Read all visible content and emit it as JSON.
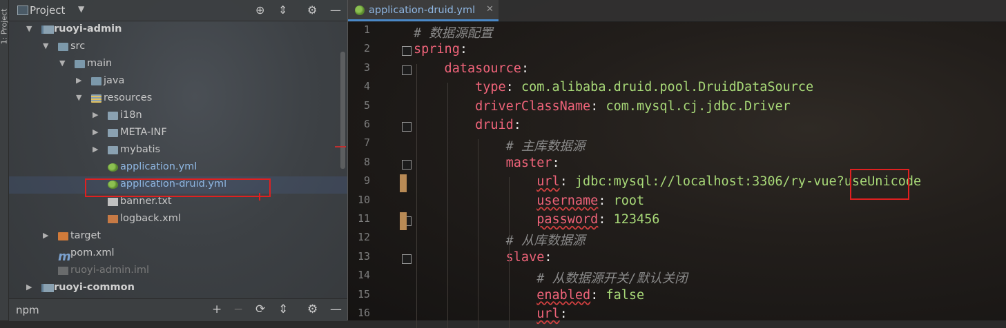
{
  "side_strip": {
    "label": "1: Project"
  },
  "project_panel": {
    "title": "Project",
    "toolbar_icons": [
      "target-icon",
      "collapse-icon",
      "gear-icon",
      "minimize-icon"
    ],
    "tree": [
      {
        "label": "ruoyi-admin",
        "kind": "module",
        "level": 0,
        "expanded": true
      },
      {
        "label": "src",
        "kind": "folder",
        "level": 1,
        "expanded": true
      },
      {
        "label": "main",
        "kind": "folder",
        "level": 2,
        "expanded": true
      },
      {
        "label": "java",
        "kind": "folder",
        "level": 3,
        "expanded": false
      },
      {
        "label": "resources",
        "kind": "folder",
        "level": 3,
        "expanded": true
      },
      {
        "label": "i18n",
        "kind": "folder",
        "level": 4,
        "expanded": false
      },
      {
        "label": "META-INF",
        "kind": "folder",
        "level": 4,
        "expanded": false
      },
      {
        "label": "mybatis",
        "kind": "folder",
        "level": 4,
        "expanded": false
      },
      {
        "label": "application.yml",
        "kind": "yml",
        "level": 4
      },
      {
        "label": "application-druid.yml",
        "kind": "yml",
        "level": 4,
        "selected": true
      },
      {
        "label": "banner.txt",
        "kind": "txt",
        "level": 4
      },
      {
        "label": "logback.xml",
        "kind": "xml",
        "level": 4
      },
      {
        "label": "target",
        "kind": "target",
        "level": 1,
        "expanded": false
      },
      {
        "label": "pom.xml",
        "kind": "maven",
        "level": 1
      },
      {
        "label": "ruoyi-admin.iml",
        "kind": "iml",
        "level": 1
      },
      {
        "label": "ruoyi-common",
        "kind": "module",
        "level": 0,
        "expanded": false
      }
    ]
  },
  "bottom_bar": {
    "label": "npm",
    "icons": [
      "add-icon",
      "remove-icon",
      "refresh-icon",
      "collapse-icon",
      "gear-icon",
      "minimize-icon"
    ]
  },
  "editor": {
    "tab": {
      "label": "application-druid.yml"
    },
    "line_numbers": [
      "1",
      "2",
      "3",
      "4",
      "5",
      "6",
      "7",
      "8",
      "9",
      "10",
      "11",
      "12",
      "13",
      "14",
      "15",
      "16"
    ],
    "lines": [
      [
        {
          "t": "# 数据源配置",
          "c": "cmt"
        }
      ],
      [
        {
          "t": "spring",
          "c": "key"
        },
        {
          "t": ":",
          "c": "white"
        }
      ],
      [
        {
          "t": "    datasource",
          "c": "key"
        },
        {
          "t": ":",
          "c": "white"
        }
      ],
      [
        {
          "t": "        type",
          "c": "key"
        },
        {
          "t": ": ",
          "c": "white"
        },
        {
          "t": "com.alibaba.druid.pool.DruidDataSource",
          "c": "val"
        }
      ],
      [
        {
          "t": "        driverClassName",
          "c": "key"
        },
        {
          "t": ": ",
          "c": "white"
        },
        {
          "t": "com.mysql.cj.jdbc.Driver",
          "c": "val"
        }
      ],
      [
        {
          "t": "        druid",
          "c": "key"
        },
        {
          "t": ":",
          "c": "white"
        }
      ],
      [
        {
          "t": "            # 主库数据源",
          "c": "cmt"
        }
      ],
      [
        {
          "t": "            master",
          "c": "key"
        },
        {
          "t": ":",
          "c": "white"
        }
      ],
      [
        {
          "t": "                ",
          "c": "white"
        },
        {
          "t": "url",
          "c": "key sq"
        },
        {
          "t": ": ",
          "c": "white"
        },
        {
          "t": "jdbc:mysql://localhost:3306/ry-vue?useUnicode",
          "c": "val"
        }
      ],
      [
        {
          "t": "                ",
          "c": "white"
        },
        {
          "t": "username",
          "c": "key sq"
        },
        {
          "t": ": ",
          "c": "white"
        },
        {
          "t": "root",
          "c": "val"
        }
      ],
      [
        {
          "t": "                ",
          "c": "white"
        },
        {
          "t": "password",
          "c": "key sq"
        },
        {
          "t": ": ",
          "c": "white"
        },
        {
          "t": "123456",
          "c": "val"
        }
      ],
      [
        {
          "t": "            # 从库数据源",
          "c": "cmt"
        }
      ],
      [
        {
          "t": "            slave",
          "c": "key"
        },
        {
          "t": ":",
          "c": "white"
        }
      ],
      [
        {
          "t": "                # 从数据源开关/默认关闭",
          "c": "cmt"
        }
      ],
      [
        {
          "t": "                ",
          "c": "white"
        },
        {
          "t": "enabled",
          "c": "key sq"
        },
        {
          "t": ": ",
          "c": "white"
        },
        {
          "t": "false",
          "c": "val"
        }
      ],
      [
        {
          "t": "                ",
          "c": "white"
        },
        {
          "t": "url",
          "c": "key sq"
        },
        {
          "t": ":",
          "c": "white"
        }
      ]
    ]
  },
  "colors": {
    "key": "#f0647a",
    "value": "#a8d978",
    "comment": "#8a8a8a",
    "highlight_box": "#e02020"
  }
}
